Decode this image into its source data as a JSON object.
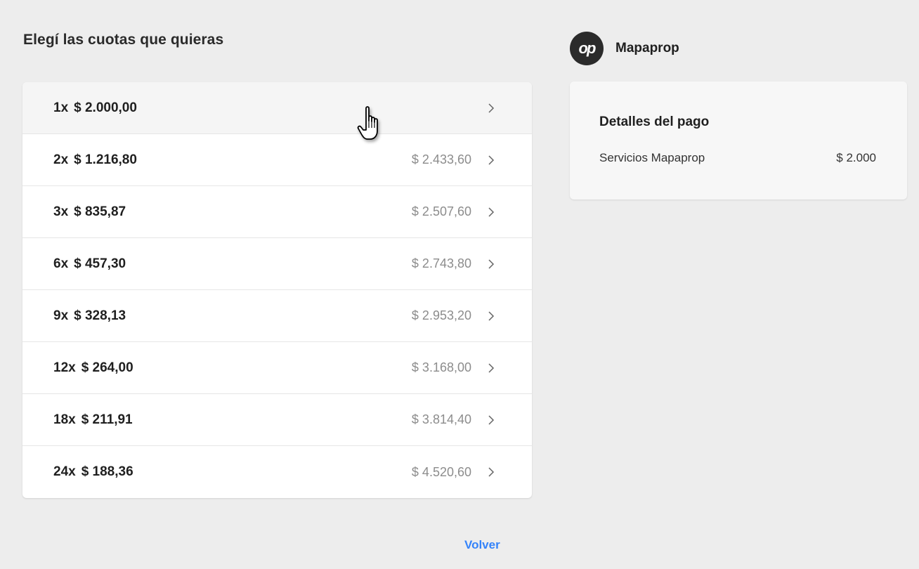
{
  "page": {
    "title": "Elegí las cuotas que quieras",
    "back_label": "Volver",
    "accent_color": "#3483fa"
  },
  "installments": [
    {
      "qty": "1x",
      "amount": "$ 2.000,00",
      "total": ""
    },
    {
      "qty": "2x",
      "amount": "$ 1.216,80",
      "total": "$ 2.433,60"
    },
    {
      "qty": "3x",
      "amount": "$ 835,87",
      "total": "$ 2.507,60"
    },
    {
      "qty": "6x",
      "amount": "$ 457,30",
      "total": "$ 2.743,80"
    },
    {
      "qty": "9x",
      "amount": "$ 328,13",
      "total": "$ 2.953,20"
    },
    {
      "qty": "12x",
      "amount": "$ 264,00",
      "total": "$ 3.168,00"
    },
    {
      "qty": "18x",
      "amount": "$ 211,91",
      "total": "$ 3.814,40"
    },
    {
      "qty": "24x",
      "amount": "$ 188,36",
      "total": "$ 4.520,60"
    }
  ],
  "merchant": {
    "name": "Mapaprop",
    "logo_icon": "mapaprop-logo-icon"
  },
  "payment_details": {
    "title": "Detalles del pago",
    "item_label": "Servicios Mapaprop",
    "item_amount": "$ 2.000"
  }
}
